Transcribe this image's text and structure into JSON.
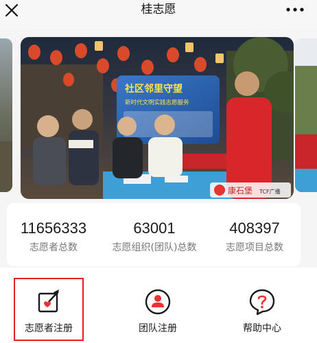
{
  "nav": {
    "title": "桂志愿",
    "close_icon": "close-icon",
    "more_icon": "more-dots-icon"
  },
  "banner": {
    "image": "volunteer-service-event-photo",
    "sign_text": "社区邻里守望",
    "sign_subtext": "新时代文明实践志愿服务",
    "logo_text": "康石堡",
    "logo_tag": "TCF广播"
  },
  "stats": [
    {
      "value": "11656333",
      "label": "志愿者总数"
    },
    {
      "value": "63001",
      "label": "志愿组织(团队)总数"
    },
    {
      "value": "408397",
      "label": "志愿项目总数"
    }
  ],
  "actions": [
    {
      "label": "志愿者注册",
      "icon": "edit-heart-icon"
    },
    {
      "label": "团队注册",
      "icon": "team-register-icon"
    },
    {
      "label": "帮助中心",
      "icon": "help-question-icon"
    }
  ],
  "colors": {
    "accent_red": "#e8332e",
    "highlight_border": "#e02020",
    "label_gray": "#777777"
  }
}
